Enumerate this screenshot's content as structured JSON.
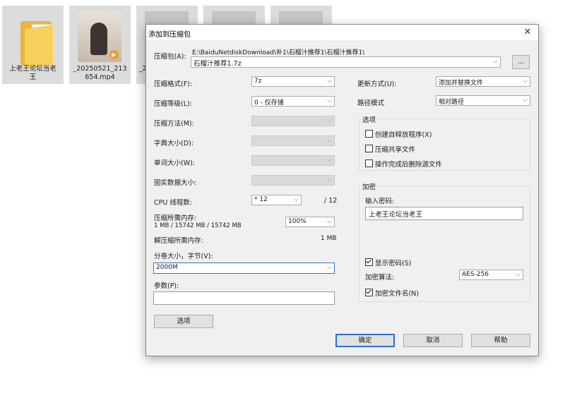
{
  "desktop": {
    "files": [
      {
        "name_line1": "上老王论坛当老",
        "name_line2": "王"
      },
      {
        "name_line1": "_20250521_213",
        "name_line2": "654.mp4"
      },
      {
        "name_line1": "_2",
        "name_line2": ""
      },
      {
        "name_line1": "",
        "name_line2": ""
      },
      {
        "name_line1": "",
        "name_line2": ""
      }
    ]
  },
  "dialog": {
    "title": "添加到压缩包",
    "close_glyph": "✕",
    "archive": {
      "label": "压缩包(A):",
      "path": "E:\\BaiduNetdiskDownload\\补1\\石榴汁推荐1\\石榴汁推荐1\\",
      "filename": "石榴汁推荐1.7z",
      "browse_label": "..."
    },
    "format": {
      "label": "压缩格式(F):",
      "value": "7z"
    },
    "level": {
      "label": "压缩等级(L):",
      "value": "0 - 仅存储"
    },
    "method": {
      "label": "压缩方法(M):",
      "value": ""
    },
    "dict": {
      "label": "字典大小(D):",
      "value": ""
    },
    "word": {
      "label": "单词大小(W):",
      "value": ""
    },
    "solid": {
      "label": "固实数据大小:",
      "value": ""
    },
    "cpu": {
      "label": "CPU 线程数:",
      "value": "* 12",
      "max": "/ 12"
    },
    "mem_compress": {
      "label": "压缩所需内存:",
      "detail": "1 MB / 15742 MB / 15742 MB",
      "percent": "100%"
    },
    "mem_decompress": {
      "label": "解压缩所需内存:",
      "value": "1 MB"
    },
    "split": {
      "label": "分卷大小，字节(V):",
      "value": "2000M"
    },
    "params": {
      "label": "参数(P):",
      "value": ""
    },
    "options_button": "选项",
    "update_mode": {
      "label": "更新方式(U):",
      "value": "添加并替换文件"
    },
    "path_mode": {
      "label": "路径模式",
      "value": "相对路径"
    },
    "options_group": {
      "title": "选项",
      "sfx": {
        "label": "创建自释放程序(X)",
        "checked": false
      },
      "shared": {
        "label": "压缩共享文件",
        "checked": false
      },
      "delete_after": {
        "label": "操作完成后删除源文件",
        "checked": false
      }
    },
    "encryption": {
      "title": "加密",
      "password_label": "输入密码:",
      "password_value": "上老王论坛当老王",
      "show_password": {
        "label": "显示密码(S)",
        "checked": true
      },
      "method_label": "加密算法:",
      "method_value": "AES-256",
      "encrypt_names": {
        "label": "加密文件名(N)",
        "checked": true
      }
    },
    "buttons": {
      "ok": "确定",
      "cancel": "取消",
      "help": "帮助"
    },
    "dropdown_arrow": "⌵"
  }
}
